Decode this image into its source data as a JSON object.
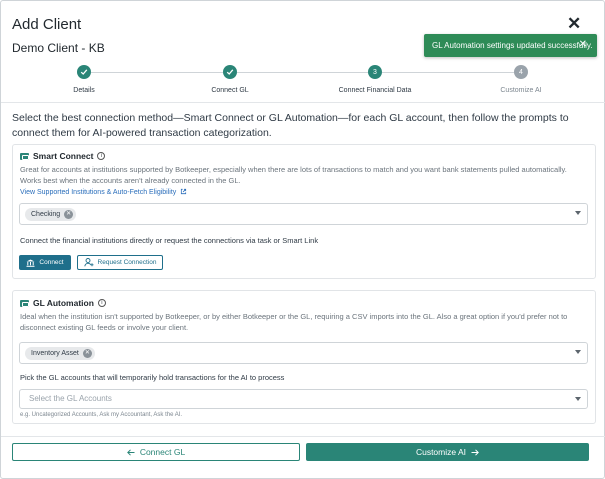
{
  "modal": {
    "title": "Add Client",
    "close_glyph": "✕",
    "client_name": "Demo Client - KB"
  },
  "toast": {
    "message": "GL Automation settings updated successfully.",
    "close_glyph": "✕"
  },
  "steps": [
    {
      "label": "Details",
      "state": "done",
      "number": "1"
    },
    {
      "label": "Connect GL",
      "state": "done",
      "number": "2"
    },
    {
      "label": "Connect Financial Data",
      "state": "active",
      "number": "3"
    },
    {
      "label": "Customize AI",
      "state": "todo",
      "number": "4"
    }
  ],
  "intro_text": "Select the best connection method—Smart Connect or GL Automation—for each GL account, then follow the prompts to connect them for AI-powered transaction categorization.",
  "smart_connect": {
    "title": "Smart Connect",
    "info_glyph": "i",
    "description": "Great for accounts at institutions supported by Botkeeper, especially when there are lots of transactions to match and you want bank statements pulled automatically. Works best when the accounts aren't already connected in the GL.",
    "link": "View Supported Institutions & Auto-Fetch Eligibility",
    "selected_chip": "Checking",
    "connect_prompt": "Connect the financial institutions directly or request the connections via task or Smart Link",
    "connect_button": "Connect",
    "request_button": "Request Connection"
  },
  "gl_automation": {
    "title": "GL Automation",
    "info_glyph": "i",
    "description": "Ideal when the institution isn't supported by Botkeeper, or by either Botkeeper or the GL, requiring a CSV imports into the GL. Also a great option if you'd prefer not to disconnect existing GL feeds or involve your client.",
    "selected_chip": "Inventory Asset",
    "hold_label": "Pick the GL accounts that will temporarily hold transactions for the AI to process",
    "hold_placeholder": "Select the GL Accounts",
    "hold_hint": "e.g. Uncategorized Accounts, Ask my Accountant, Ask the AI."
  },
  "footer": {
    "back_button": "Connect GL",
    "next_button": "Customize AI"
  },
  "colors": {
    "accent": "#2a8577",
    "connect_blue": "#1f6f8b",
    "toast_green": "#2e8b57",
    "link_blue": "#2a6ebb"
  },
  "icons": {
    "close": "close-icon",
    "check": "check-icon",
    "card": "card-icon",
    "info": "info-icon",
    "external_link": "external-link-icon",
    "bank": "bank-icon",
    "request_user": "user-plus-icon",
    "arrow_left": "arrow-left-icon",
    "arrow_right": "arrow-right-icon",
    "chevron_down": "chevron-down-icon"
  }
}
